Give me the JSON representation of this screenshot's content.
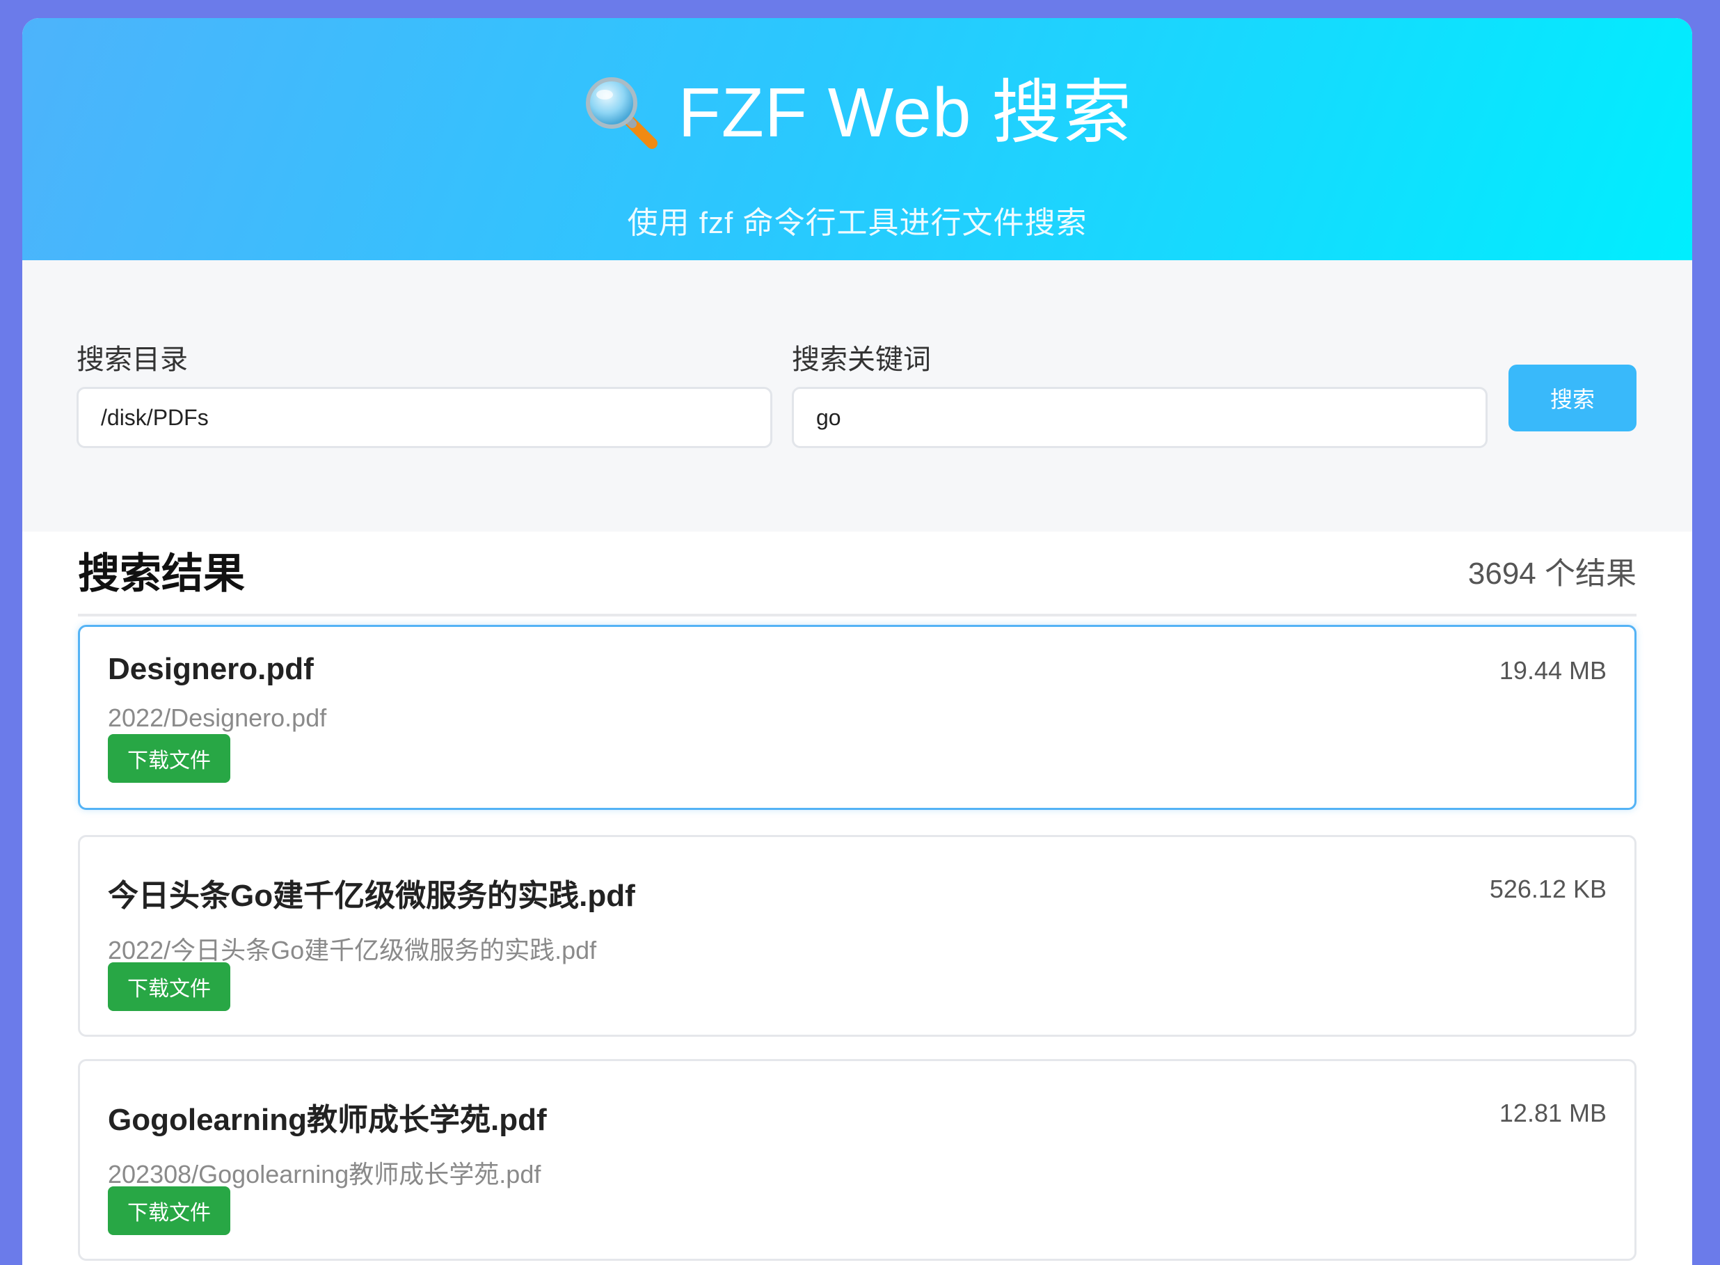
{
  "header": {
    "title": "FZF Web 搜索",
    "subtitle": "使用 fzf 命令行工具进行文件搜索"
  },
  "search": {
    "dir_label": "搜索目录",
    "dir_value": "/disk/PDFs",
    "keyword_label": "搜索关键词",
    "keyword_value": "go",
    "button_label": "搜索"
  },
  "results": {
    "title": "搜索结果",
    "count": "3694 个结果",
    "download_label": "下载文件",
    "items": [
      {
        "name": "Designero.pdf",
        "path": "2022/Designero.pdf",
        "size": "19.44 MB"
      },
      {
        "name": "今日头条Go建千亿级微服务的实践.pdf",
        "path": "2022/今日头条Go建千亿级微服务的实践.pdf",
        "size": "526.12 KB"
      },
      {
        "name": "Gogolearning教师成长学苑.pdf",
        "path": "202308/Gogolearning教师成长学苑.pdf",
        "size": "12.81 MB"
      }
    ]
  },
  "colors": {
    "page_bg": "#6b7bea",
    "header_start": "#4db3fb",
    "header_end": "#00eefe",
    "search_button": "#39b9fa",
    "download_button": "#28a745",
    "active_border": "#54b3f5"
  },
  "icons": {
    "title_icon": "magnifying-glass-icon"
  }
}
